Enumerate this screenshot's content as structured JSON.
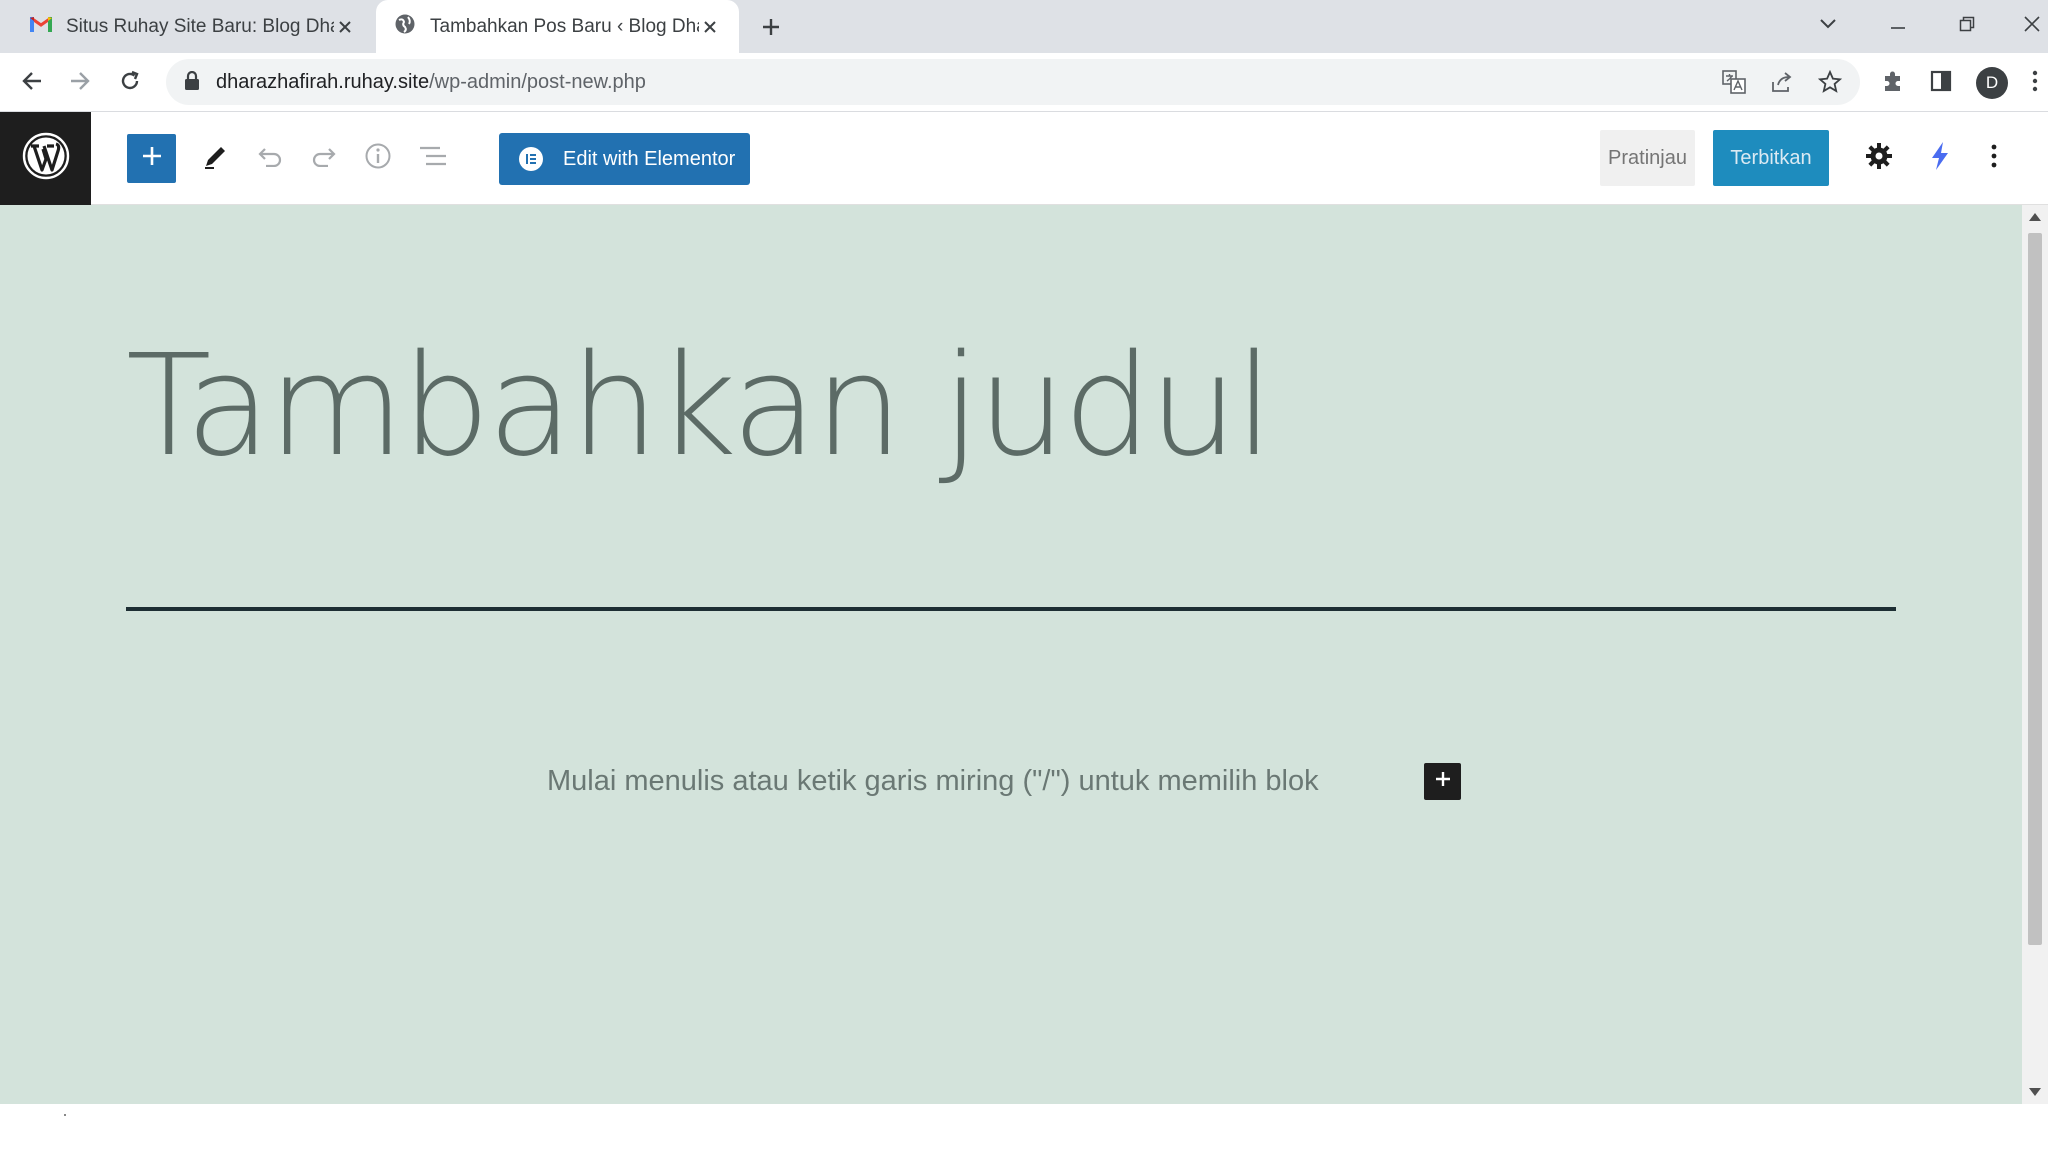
{
  "browser": {
    "tabs": [
      {
        "title": "Situs Ruhay Site Baru: Blog Dhara",
        "favicon": "gmail-icon",
        "active": false
      },
      {
        "title": "Tambahkan Pos Baru ‹ Blog Dhara",
        "favicon": "globe-icon",
        "active": true
      }
    ],
    "address": {
      "host": "dharazhafirah.ruhay.site",
      "path": "/wp-admin/post-new.php"
    },
    "profile_initial": "D"
  },
  "editor_header": {
    "elementor_label": "Edit with Elementor",
    "preview_label": "Pratinjau",
    "publish_label": "Terbitkan"
  },
  "canvas": {
    "title_placeholder": "Tambahkan judul",
    "block_placeholder": "Mulai menulis atau ketik garis miring (\"/\") untuk memilih blok"
  },
  "colors": {
    "wp_blue": "#2271b1",
    "canvas_bg": "#d3e3db",
    "title_text": "#5c6b66",
    "separator": "#1d2e33"
  }
}
